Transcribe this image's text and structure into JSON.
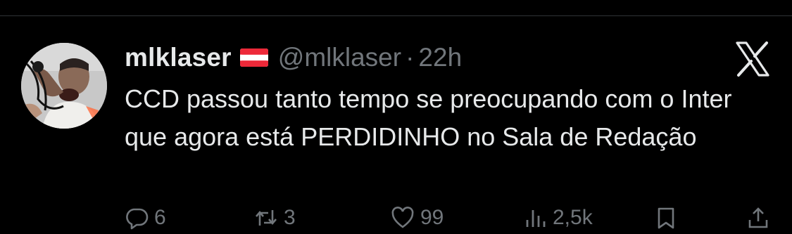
{
  "tweet": {
    "display_name": "mlklaser",
    "flag_icon": "austria-flag-icon",
    "handle": "@mlklaser",
    "separator": "·",
    "time": "22h",
    "text": "CCD passou tanto tempo se preocupando com o Inter que agora está PERDIDINHO no Sala de Redação"
  },
  "header_icon": "x-logo-icon",
  "actions": {
    "replies": {
      "icon": "reply-icon",
      "count": "6"
    },
    "retweets": {
      "icon": "retweet-icon",
      "count": "3"
    },
    "likes": {
      "icon": "heart-icon",
      "count": "99"
    },
    "views": {
      "icon": "views-icon",
      "count": "2,5k"
    },
    "bookmark": {
      "icon": "bookmark-icon"
    },
    "share": {
      "icon": "share-icon"
    }
  },
  "colors": {
    "background": "#000000",
    "text_primary": "#e7e9ea",
    "text_secondary": "#71767b",
    "divider": "#2f3336",
    "flag_red": "#ed2939"
  }
}
